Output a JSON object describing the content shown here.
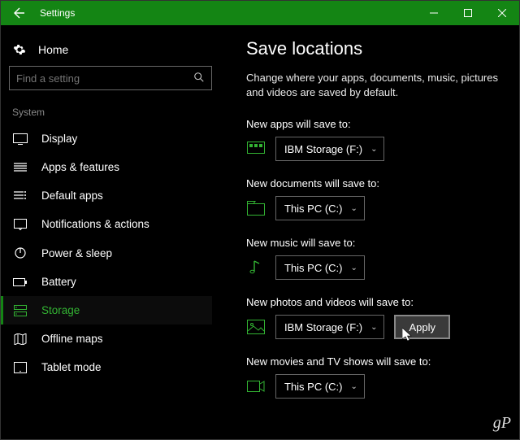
{
  "window": {
    "app_title": "Settings"
  },
  "sidebar": {
    "home_label": "Home",
    "search_placeholder": "Find a setting",
    "group_label": "System",
    "items": [
      {
        "label": "Display",
        "icon": "display-icon"
      },
      {
        "label": "Apps & features",
        "icon": "apps-icon"
      },
      {
        "label": "Default apps",
        "icon": "default-apps-icon"
      },
      {
        "label": "Notifications & actions",
        "icon": "notifications-icon"
      },
      {
        "label": "Power & sleep",
        "icon": "power-icon"
      },
      {
        "label": "Battery",
        "icon": "battery-icon"
      },
      {
        "label": "Storage",
        "icon": "storage-icon",
        "active": true
      },
      {
        "label": "Offline maps",
        "icon": "maps-icon"
      },
      {
        "label": "Tablet mode",
        "icon": "tablet-icon"
      }
    ]
  },
  "page": {
    "title": "Save locations",
    "description": "Change where your apps, documents, music, pictures and videos are saved by default.",
    "apply_label": "Apply",
    "locations": [
      {
        "label": "New apps will save to:",
        "value": "IBM Storage (F:)",
        "icon": "apps-drive-icon"
      },
      {
        "label": "New documents will save to:",
        "value": "This PC (C:)",
        "icon": "documents-drive-icon"
      },
      {
        "label": "New music will save to:",
        "value": "This PC (C:)",
        "icon": "music-drive-icon"
      },
      {
        "label": "New photos and videos will save to:",
        "value": "IBM Storage (F:)",
        "icon": "photos-drive-icon",
        "show_apply": true
      },
      {
        "label": "New movies and TV shows will save to:",
        "value": "This PC (C:)",
        "icon": "movies-drive-icon"
      }
    ]
  },
  "watermark": "gP"
}
